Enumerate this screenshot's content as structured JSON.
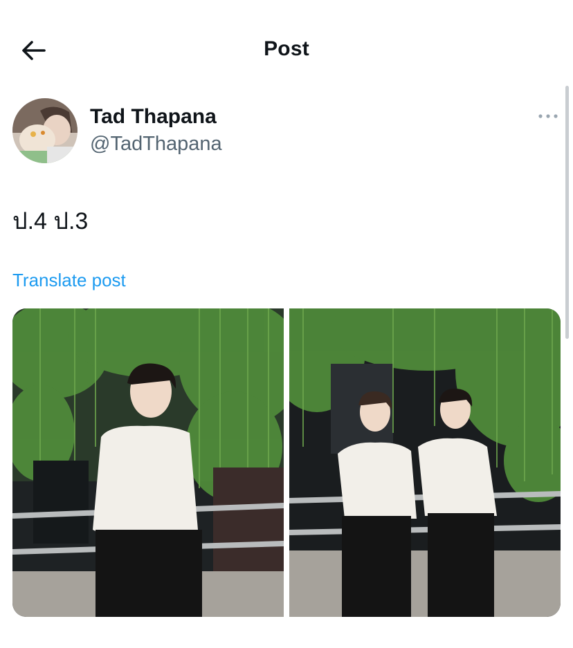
{
  "header": {
    "title": "Post",
    "back_icon": "arrow-left-icon"
  },
  "author": {
    "display_name": "Tad Thapana",
    "handle": "@TadThapana",
    "more_icon": "more-horizontal-icon"
  },
  "post": {
    "text": "ป.4 ป.3",
    "translate_label": "Translate post"
  },
  "media": {
    "count": 2,
    "photo_1_icon": "photo",
    "photo_2_icon": "photo"
  },
  "colors": {
    "link": "#1d9bf0",
    "secondary_text": "#536471",
    "primary_text": "#0f1419"
  }
}
